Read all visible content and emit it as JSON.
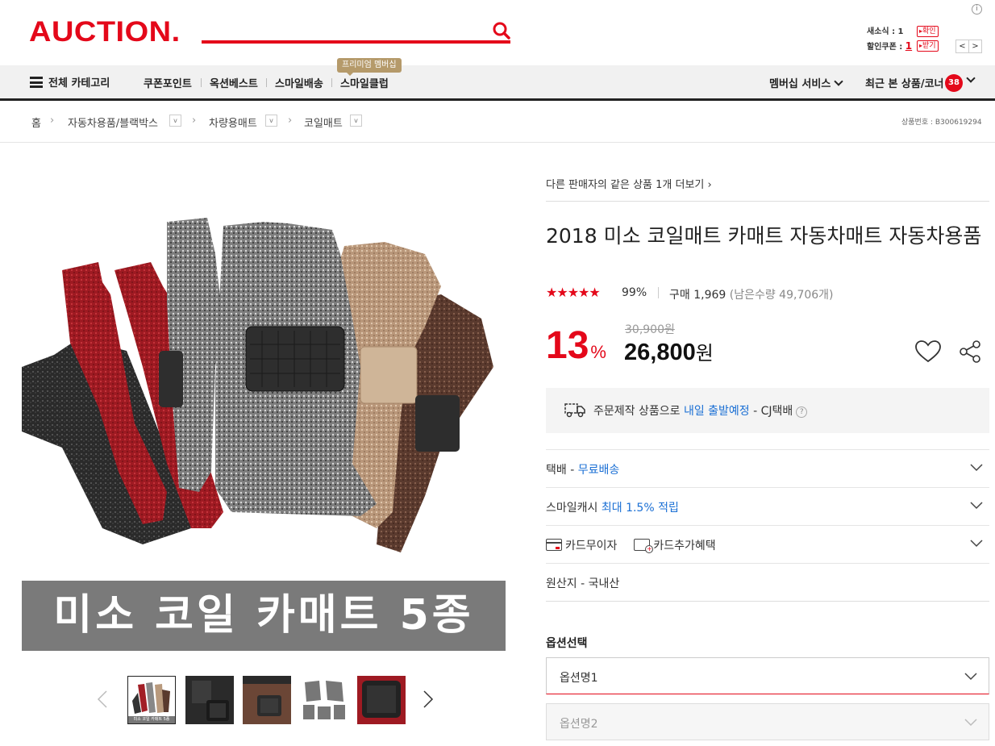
{
  "header": {
    "logo": "AUCTION.",
    "news_label": "새소식 : 1",
    "news_button": "확인",
    "coupon_label": "할인쿠폰 : ",
    "coupon_count": "1",
    "coupon_button": "받기",
    "info_symbol": "i",
    "prev_arrow": "<",
    "next_arrow": ">"
  },
  "nav": {
    "all_categories": "전체 카테고리",
    "items": [
      "쿠폰포인트",
      "옥션베스트",
      "스마일배송",
      "스마일클럽"
    ],
    "premium_badge": "프리미엄 멤버십",
    "membership": "멤버십 서비스",
    "recent": "최근 본 상품/코너",
    "recent_count": "38"
  },
  "breadcrumb": {
    "home": "홈",
    "items": [
      "자동차용품/블랙박스",
      "차량용매트",
      "코일매트"
    ],
    "product_no": "상품번호 : B300619294"
  },
  "image": {
    "banner": "미소 코일 카매트 5종",
    "thumb1_caption": "미소 코일 카매트 5종"
  },
  "product": {
    "other_sellers": "다른 판매자의 같은 상품 1개 더보기",
    "title": "2018 미소 코일매트 카매트 자동차매트 자동차용품",
    "stars": "★★★★★",
    "rating": "99%",
    "purchase_label": "구매 1,969",
    "remaining": "(남은수량 49,706개)",
    "discount": "13",
    "discount_unit": "%",
    "original_price": "30,900원",
    "price": "26,800",
    "price_unit": "원"
  },
  "shipping": {
    "prefix": "주문제작 상품으로",
    "highlight": "내일 출발예정",
    "suffix": "- CJ택배",
    "help": "?"
  },
  "rows": {
    "delivery_label": "택배 - ",
    "delivery_value": "무료배송",
    "cash_label": "스마일캐시 ",
    "cash_value": "최대 1.5% 적립",
    "card_interest": "카드무이자",
    "card_benefit": "카드추가혜택",
    "origin": "원산지 - 국내산"
  },
  "options": {
    "title": "옵션선택",
    "option1": "옵션명1",
    "option2": "옵션명2"
  },
  "colors": {
    "brand_red": "#e4081a",
    "link_blue": "#1a6fd4",
    "banner_gray": "#7a7a7a"
  }
}
